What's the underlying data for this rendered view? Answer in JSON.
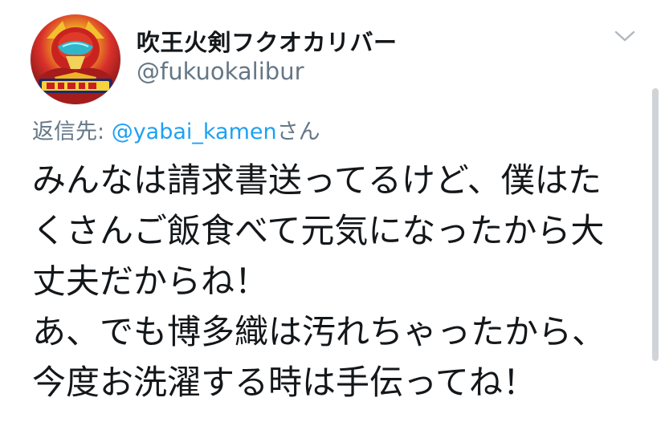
{
  "tweet": {
    "display_name": "吹王火剣フクオカリバー",
    "handle": "@fukuokalibur",
    "reply_prefix": "返信先: ",
    "reply_mention": "@yabai_kamen",
    "reply_suffix": "さん",
    "body_lines": [
      "みんなは請求書送ってるけど、僕はた",
      "くさんご飯食べて元気になったから大",
      "丈夫だからね！",
      "あ、でも博多織は汚れちゃったから、",
      "今度お洗濯する時は手伝ってね！"
    ]
  },
  "icons": {
    "menu": "chevron-down-icon",
    "avatar": "hero-mask-avatar"
  },
  "colors": {
    "text": "#14171a",
    "secondary": "#657786",
    "link": "#1da1f2"
  }
}
